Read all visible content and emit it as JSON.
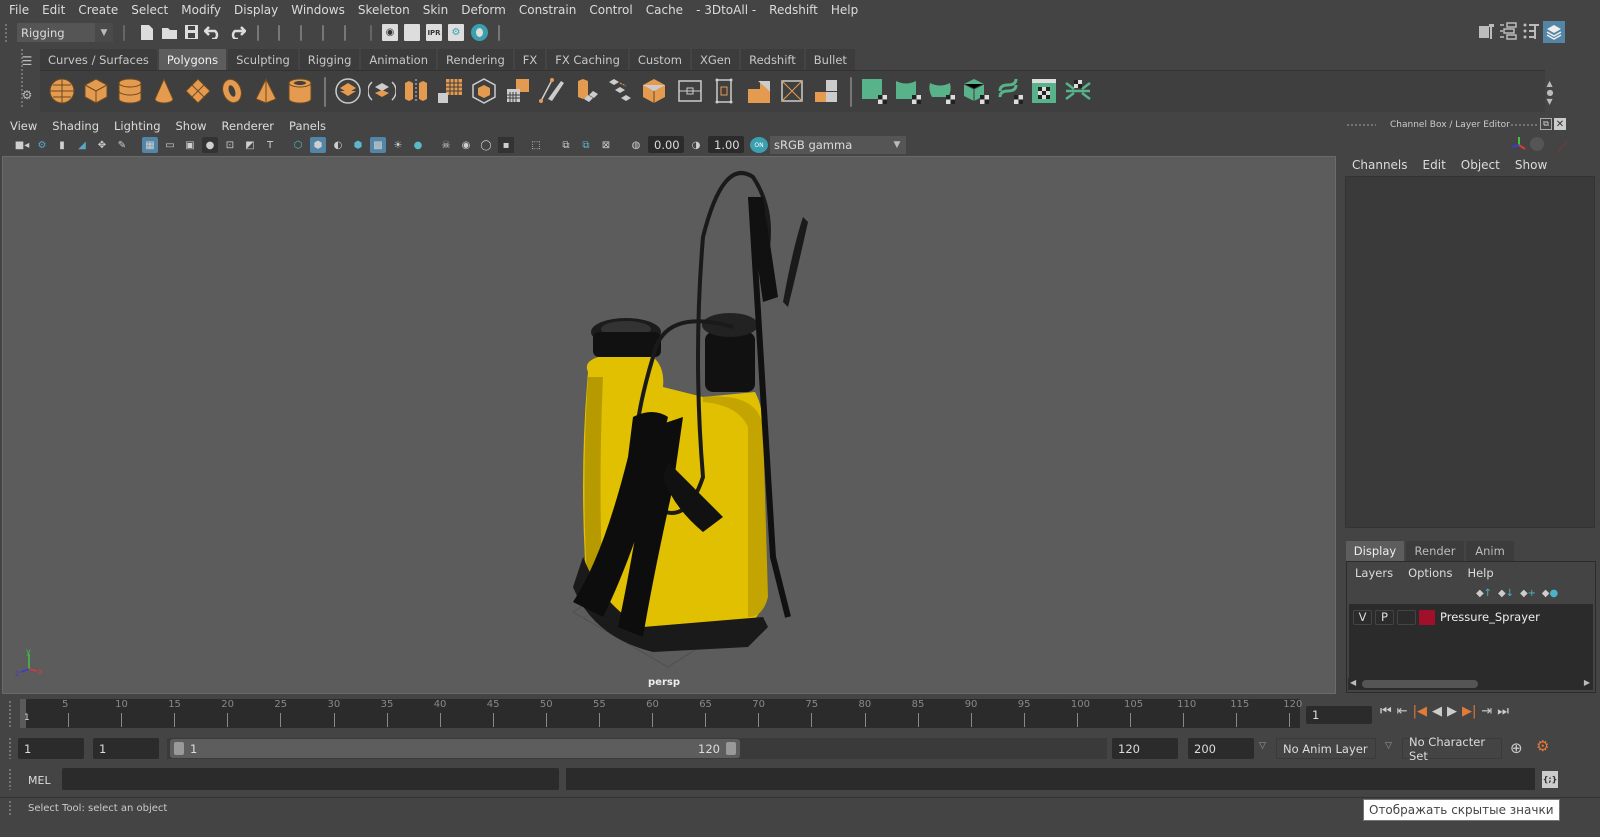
{
  "menubar": [
    "File",
    "Edit",
    "Create",
    "Select",
    "Modify",
    "Display",
    "Windows",
    "Skeleton",
    "Skin",
    "Deform",
    "Constrain",
    "Control",
    "Cache",
    "- 3DtoAll -",
    "Redshift",
    "Help"
  ],
  "statusline": {
    "menuset": "Rigging",
    "icons": [
      "new-scene",
      "open-scene",
      "save-scene",
      "undo",
      "redo",
      "render-view",
      "render-frame",
      "ipr-render",
      "render-settings",
      "hypershade"
    ],
    "right_icons": [
      "modeling-toolkit",
      "attribute-editor",
      "tool-settings",
      "channel-box-layer-editor"
    ]
  },
  "shelf": {
    "tabs": [
      "Curves / Surfaces",
      "Polygons",
      "Sculpting",
      "Rigging",
      "Animation",
      "Rendering",
      "FX",
      "FX Caching",
      "Custom",
      "XGen",
      "Redshift",
      "Bullet"
    ],
    "active_tab": "Polygons",
    "primitive_icons": [
      "poly-sphere",
      "poly-cube",
      "poly-cylinder",
      "poly-cone",
      "poly-plane",
      "poly-torus",
      "poly-pyramid",
      "poly-pipe"
    ],
    "tool_icons": [
      "combine",
      "separate",
      "mirror",
      "smooth",
      "extract",
      "booleans",
      "bevel",
      "bridge",
      "extrude",
      "multi-cut",
      "target-weld",
      "triangulate",
      "quadrangulate",
      "fill-hole",
      "append-polygon",
      "split",
      "reduce"
    ],
    "uv_icons": [
      "planar-uv",
      "cylindrical-uv",
      "spherical-uv",
      "automatic-uv",
      "unfold-uv",
      "uv-editor",
      "layout-uv"
    ]
  },
  "viewport": {
    "menu": [
      "View",
      "Shading",
      "Lighting",
      "Show",
      "Renderer",
      "Panels"
    ],
    "exposure": "0.00",
    "gamma": "1.00",
    "color_mgmt": "ON",
    "color_space": "sRGB gamma",
    "camera_label": "persp",
    "axis": {
      "x": "x",
      "y": "y",
      "z": "z"
    }
  },
  "right_panel": {
    "title": "Channel Box / Layer Editor",
    "channel_menu": [
      "Channels",
      "Edit",
      "Object",
      "Show"
    ],
    "layer_tabs": [
      "Display",
      "Render",
      "Anim"
    ],
    "active_layer_tab": "Display",
    "layer_menu": [
      "Layers",
      "Options",
      "Help"
    ],
    "layers": [
      {
        "v": "V",
        "p": "P",
        "color": "#a1102a",
        "name": "Pressure_Sprayer"
      }
    ]
  },
  "timeline": {
    "ticks": [
      "5",
      "10",
      "15",
      "20",
      "25",
      "30",
      "35",
      "40",
      "45",
      "50",
      "55",
      "60",
      "65",
      "70",
      "75",
      "80",
      "85",
      "90",
      "95",
      "100",
      "105",
      "110",
      "115",
      "120"
    ],
    "current_frame_marker": "1",
    "current_frame": "1",
    "start_min": "1",
    "start": "1",
    "range_start_label": "1",
    "range_end_label": "120",
    "end": "120",
    "end_max": "200",
    "anim_layer": "No Anim Layer",
    "character_set": "No Character Set"
  },
  "commandline": {
    "label": "MEL"
  },
  "helpline": {
    "text": "Select Tool: select an object"
  },
  "tooltip": {
    "text": "Отображать скрытые значки"
  },
  "colors": {
    "accent": "#5285a6",
    "shelf_poly": "#e59b4f",
    "shelf_uv": "#58b38a",
    "layer": "#a1102a",
    "playback": "#e07b39"
  }
}
